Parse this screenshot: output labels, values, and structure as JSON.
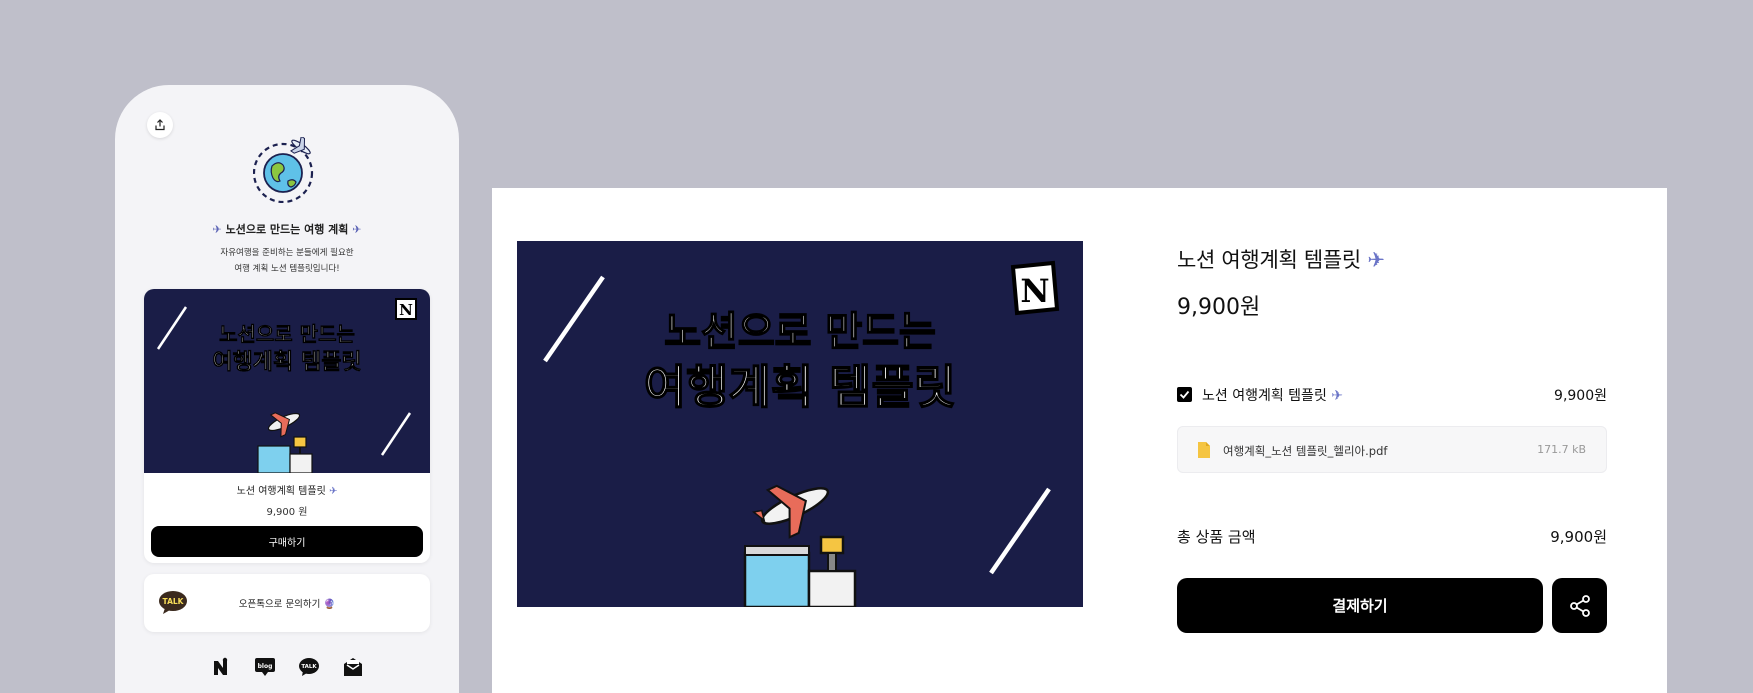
{
  "colors": {
    "background": "#bfbfca",
    "navy": "#1a1d47",
    "black": "#000000",
    "accent": "#6a74c7"
  },
  "phone": {
    "share_icon": "share-upload-icon",
    "logo_icon": "globe-airplane-icon",
    "title": "노션으로 만드는 여행 계획",
    "title_emoji": "✈",
    "desc_line1": "자유여행을 준비하는 분들에게 필요한",
    "desc_line2": "여행 계획 노션 템플릿입니다!",
    "thumb_line1": "노션으로 만드는",
    "thumb_line2": "여행계획 템플릿",
    "product_name": "노션 여행계획 템플릿",
    "product_price": "9,900 원",
    "buy_label": "구매하기",
    "talk_badge": "TALK",
    "talk_label": "오픈톡으로 문의하기",
    "talk_emoji": "🔮",
    "social": [
      "naver-icon",
      "blog-icon",
      "kakaotalk-icon",
      "mail-icon"
    ],
    "social_texts": {
      "blog": "blog",
      "talk": "TALK"
    }
  },
  "checkout": {
    "hero_line1": "노션으로 만드는",
    "hero_line2": "여행계획 템플릿",
    "notion_mark": "N",
    "title": "노션 여행계획 템플릿",
    "title_emoji": "✈",
    "price": "9,900원",
    "option_checked": true,
    "option_name": "노션 여행계획 템플릿",
    "option_price": "9,900원",
    "file_name": "여행계획_노션 템플릿_헬리아.pdf",
    "file_size": "171.7 kB",
    "total_label": "총 상품 금액",
    "total_price": "9,900원",
    "pay_label": "결제하기",
    "share_icon": "share-nodes-icon"
  }
}
